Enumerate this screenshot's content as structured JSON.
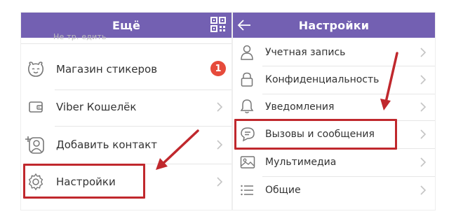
{
  "left_panel": {
    "title": "Ещё",
    "ghost_text": "Не тр. едить",
    "items": [
      {
        "label": "Магазин стикеров",
        "icon": "sticker-face-icon",
        "badge": "1"
      },
      {
        "label": "Viber Кошелёк",
        "icon": "wallet-icon"
      },
      {
        "label": "Добавить контакт",
        "icon": "add-contact-icon"
      },
      {
        "label": "Настройки",
        "icon": "gear-icon"
      }
    ]
  },
  "right_panel": {
    "title": "Настройки",
    "items": [
      {
        "label": "Учетная запись",
        "icon": "user-icon"
      },
      {
        "label": "Конфиденциальность",
        "icon": "lock-icon"
      },
      {
        "label": "Уведомления",
        "icon": "bell-icon"
      },
      {
        "label": "Вызовы и сообщения",
        "icon": "chat-bubble-icon"
      },
      {
        "label": "Мультимедиа",
        "icon": "image-icon"
      },
      {
        "label": "Общие",
        "icon": "list-icon"
      }
    ]
  },
  "colors": {
    "header": "#7360b2",
    "highlight": "#c0282d",
    "badge": "#e64b3b",
    "icon": "#777777",
    "chevron": "#c4c4c4"
  }
}
